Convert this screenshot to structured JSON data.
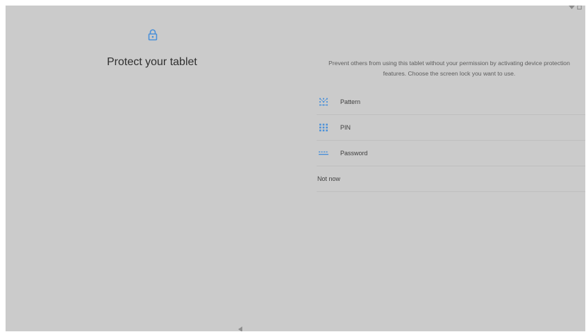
{
  "screen": {
    "title": "Protect your tablet",
    "description": "Prevent others from using this tablet without your permission by activating device protection features. Choose the screen lock you want to use.",
    "accent_color": "#4a90d9",
    "background_color": "#cbcbcb",
    "header_icon": "lock-icon"
  },
  "options": [
    {
      "label": "Pattern",
      "icon": "pattern-icon"
    },
    {
      "label": "PIN",
      "icon": "pin-icon"
    },
    {
      "label": "Password",
      "icon": "password-icon"
    },
    {
      "label": "Not now"
    }
  ],
  "status_bar": {
    "icons": [
      "wifi-icon",
      "battery-icon"
    ]
  },
  "navigation_bar": {
    "icons": [
      "back-icon"
    ]
  }
}
